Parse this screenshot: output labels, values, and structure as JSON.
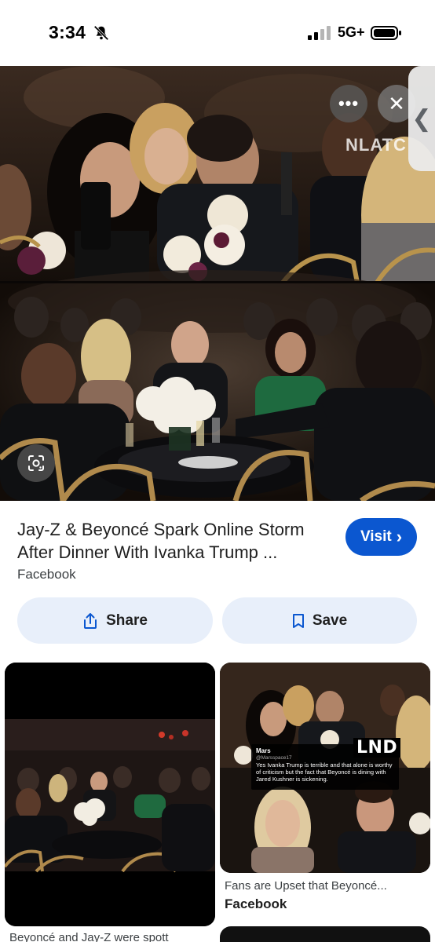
{
  "status_bar": {
    "time": "3:34",
    "network": "5G+",
    "icons": [
      "bell-slash-icon",
      "signal-icon",
      "battery-icon"
    ]
  },
  "hero": {
    "watermark": "NLATC",
    "more_label": "•••",
    "close_label": "✕",
    "side_tab_label": "❮",
    "lens_icon": "google-lens-icon"
  },
  "result": {
    "title": "Jay-Z & Beyoncé Spark Online Storm After Dinner With Ivanka Trump ...",
    "source": "Facebook",
    "visit_label": "Visit",
    "visit_arrow": "›",
    "share_label": "Share",
    "save_label": "Save"
  },
  "related": [
    {
      "caption": "Beyoncé and Jay-Z were spott",
      "source": ""
    },
    {
      "caption": "Fans are Upset that Beyoncé...",
      "source": "Facebook",
      "overlay_logo": "LND",
      "tweet": {
        "name": "Mars",
        "handle": "@Marsspace17",
        "text": "Yes Ivanka Trump is terrible and that alone is worthy of criticism but the fact that Beyoncé is dining with Jared Kushner is sickening."
      }
    }
  ],
  "colors": {
    "accent": "#0b57d0",
    "chip_bg": "#e8effa"
  }
}
